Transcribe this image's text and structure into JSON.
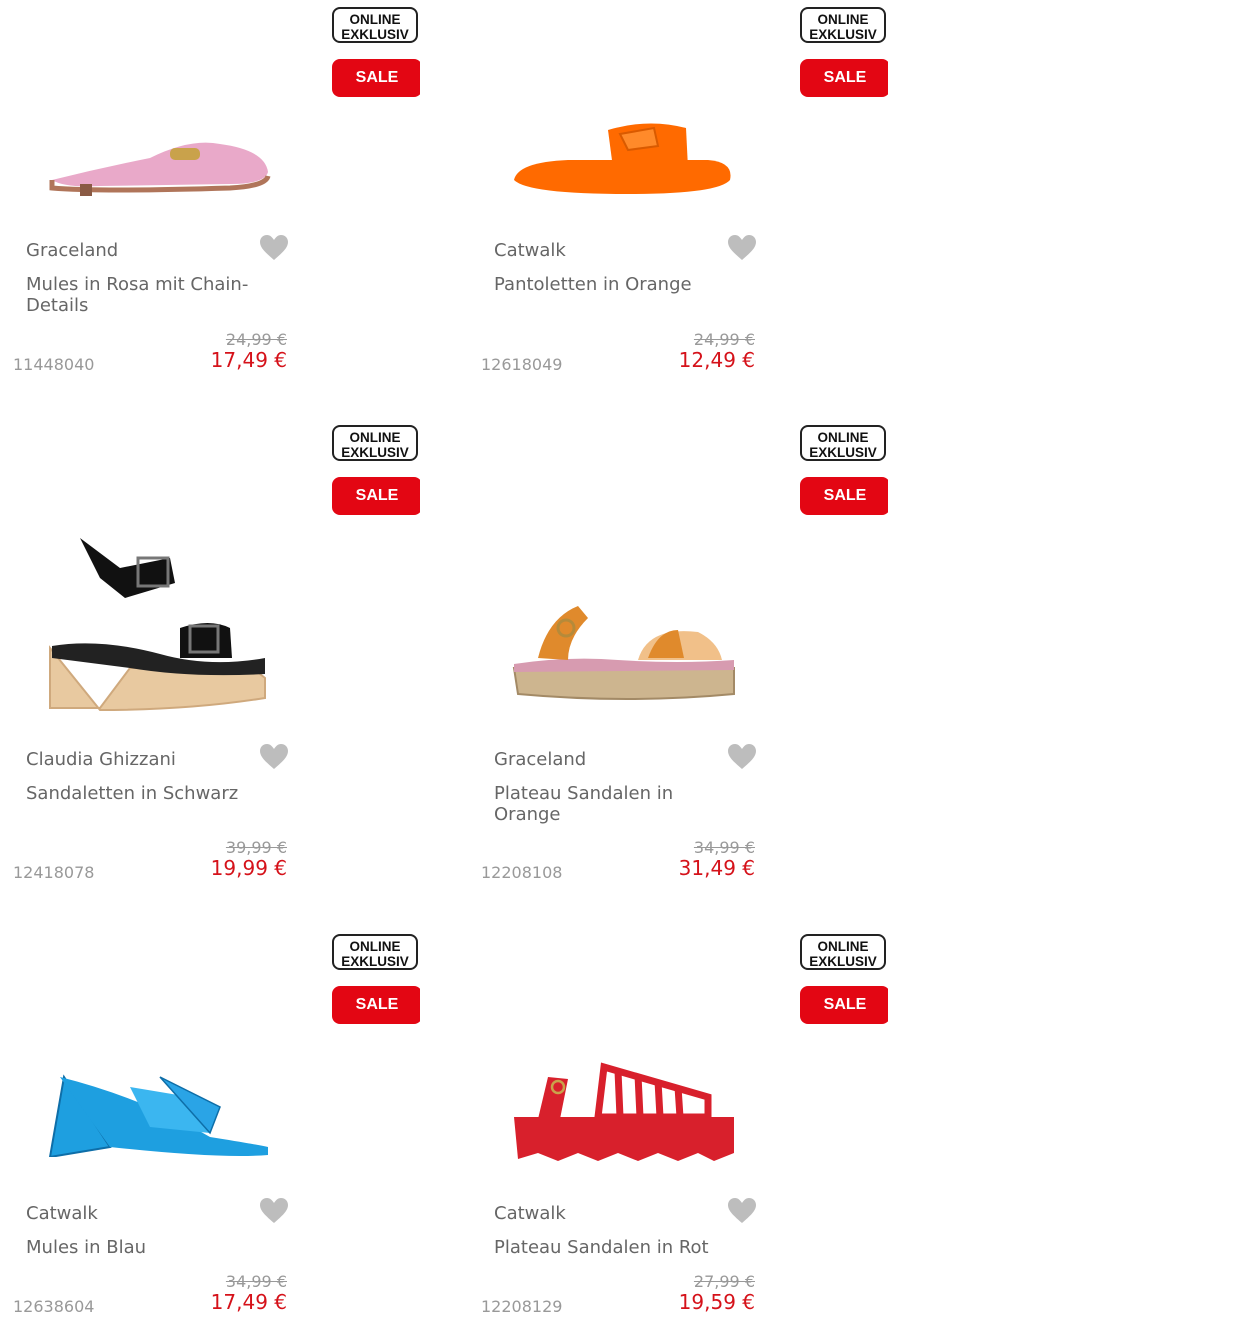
{
  "products": [
    {
      "brand": "Graceland",
      "title": "Mules in Rosa mit Chain-Details",
      "old_price": "24,99 €",
      "new_price": "17,49 €",
      "sku": "11448040",
      "badge_online": "ONLINE EXKLUSIV",
      "badge_sale": "SALE",
      "image": "pink-mule-shoe",
      "color": "#e9a9c9"
    },
    {
      "brand": "Catwalk",
      "title": "Pantoletten in Orange",
      "old_price": "24,99 €",
      "new_price": "12,49 €",
      "sku": "12618049",
      "badge_online": "ONLINE EXKLUSIV",
      "badge_sale": "SALE",
      "image": "orange-slide-sandal",
      "color": "#ff6a00"
    },
    {
      "brand": "Claudia Ghizzani",
      "title": "Sandaletten in Schwarz",
      "old_price": "39,99 €",
      "new_price": "19,99 €",
      "sku": "12418078",
      "badge_online": "ONLINE EXKLUSIV",
      "badge_sale": "SALE",
      "image": "black-platform-sandal",
      "color": "#111111"
    },
    {
      "brand": "Graceland",
      "title": "Plateau Sandalen in Orange",
      "old_price": "34,99 €",
      "new_price": "31,49 €",
      "sku": "12208108",
      "badge_online": "ONLINE EXKLUSIV",
      "badge_sale": "SALE",
      "image": "orange-espadrille-sandal",
      "color": "#e08a2c"
    },
    {
      "brand": "Catwalk",
      "title": "Mules in Blau",
      "old_price": "34,99 €",
      "new_price": "17,49 €",
      "sku": "12638604",
      "badge_online": "ONLINE EXKLUSIV",
      "badge_sale": "SALE",
      "image": "blue-heel-mule",
      "color": "#1e9fe0"
    },
    {
      "brand": "Catwalk",
      "title": "Plateau Sandalen in Rot",
      "old_price": "27,99 €",
      "new_price": "19,59 €",
      "sku": "12208129",
      "badge_online": "ONLINE EXKLUSIV",
      "badge_sale": "SALE",
      "image": "red-platform-sandal",
      "color": "#d8202c"
    }
  ],
  "colors": {
    "sale_badge": "#e30613",
    "price": "#d5121a",
    "favorite_icon": "#bdbdbd"
  }
}
